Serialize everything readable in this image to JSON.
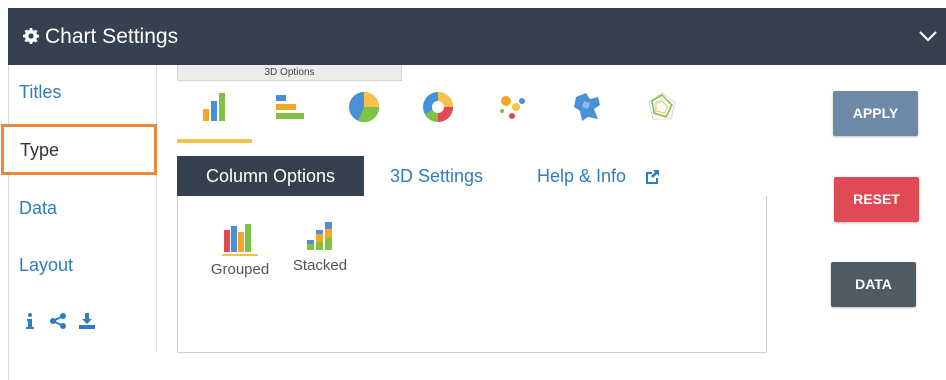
{
  "header": {
    "title": "Chart Settings",
    "gear_icon": "gear-icon",
    "collapse_icon": "chevron-down-icon",
    "bg_color": "#364150"
  },
  "sidebar": {
    "items": [
      {
        "label": "Titles",
        "active": false
      },
      {
        "label": "Type",
        "active": true
      },
      {
        "label": "Data",
        "active": false
      },
      {
        "label": "Layout",
        "active": false
      }
    ],
    "icons": [
      "info-icon",
      "share-icon",
      "download-icon"
    ],
    "highlight_color": "#e8893a"
  },
  "options_tab": {
    "label": "3D Options"
  },
  "chart_types": [
    {
      "name": "column-chart-icon",
      "selected": true
    },
    {
      "name": "bar-chart-icon",
      "selected": false
    },
    {
      "name": "pie-chart-icon",
      "selected": false
    },
    {
      "name": "donut-chart-icon",
      "selected": false
    },
    {
      "name": "scatter-chart-icon",
      "selected": false
    },
    {
      "name": "map-chart-icon",
      "selected": false
    },
    {
      "name": "radar-chart-icon",
      "selected": false
    }
  ],
  "tabs": [
    {
      "label": "Column Options",
      "active": true
    },
    {
      "label": "3D Settings",
      "active": false
    },
    {
      "label": "Help & Info",
      "active": false,
      "icon": "external-link-icon"
    }
  ],
  "column_options": [
    {
      "label": "Grouped",
      "selected": true
    },
    {
      "label": "Stacked",
      "selected": false
    }
  ],
  "buttons": {
    "apply": "APPLY",
    "reset": "RESET",
    "data": "DATA"
  },
  "colors": {
    "accent_blue": "#2f7dbd",
    "selected_underline": "#f5c24a",
    "apply": "#6c89a8",
    "reset": "#e04a55",
    "data": "#4f5b62"
  }
}
